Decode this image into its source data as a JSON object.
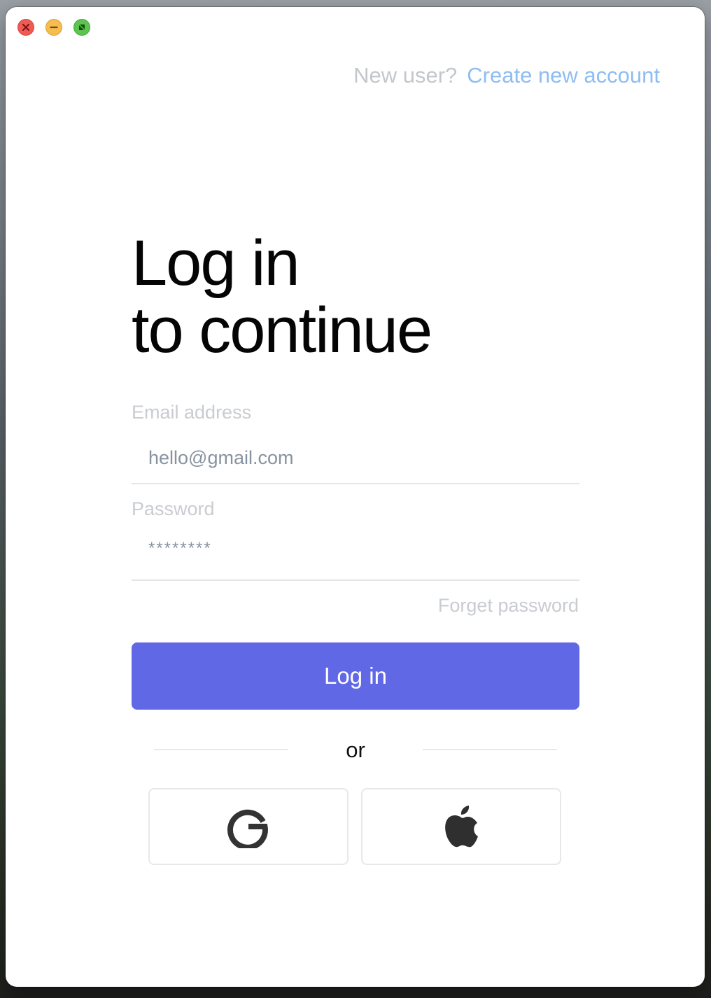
{
  "window": {
    "controls": [
      "close-icon",
      "minimize-icon",
      "zoom-icon"
    ]
  },
  "header": {
    "prompt": "New user?",
    "create_link": "Create new account"
  },
  "title": {
    "line1": "Log in",
    "line2": "to continue"
  },
  "form": {
    "email_label": "Email address",
    "email_value": "hello@gmail.com",
    "password_label": "Password",
    "password_value": "********",
    "forget_link": "Forget password",
    "submit_label": "Log in"
  },
  "divider": {
    "text": "or"
  },
  "social": {
    "buttons": [
      {
        "icon": "google-icon"
      },
      {
        "icon": "apple-icon"
      }
    ]
  },
  "colors": {
    "accent": "#6168e6",
    "link": "#8fbdf2",
    "muted_text": "#c9ccd0",
    "field_text": "#8893a0"
  }
}
